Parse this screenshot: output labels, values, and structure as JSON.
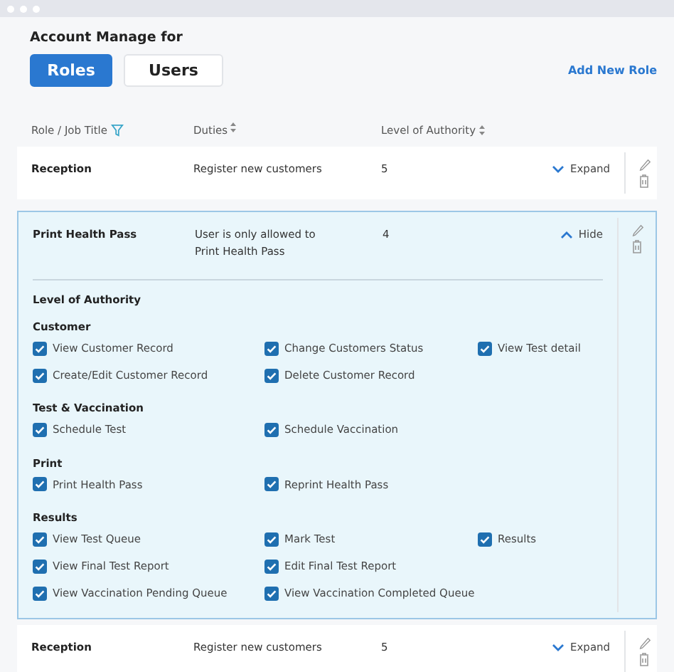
{
  "title": "Account Manage for",
  "tabs": [
    {
      "label": "Roles",
      "selected": true
    },
    {
      "label": "Users",
      "selected": false
    }
  ],
  "add_link": "Add New Role",
  "columns": [
    {
      "label": "Role / Job Title",
      "kind": "filter"
    },
    {
      "label": "Duties",
      "kind": "sort"
    },
    {
      "label": "Level of Authority",
      "kind": "sort"
    }
  ],
  "roles": [
    {
      "title": "Reception",
      "duties": "Register new customers",
      "level": "5",
      "expanded": false,
      "toggle": "Expand"
    },
    {
      "title": "Print Health Pass",
      "duties": "User is only allowed to Print Health Pass",
      "level": "4",
      "expanded": true,
      "toggle": "Hide",
      "permissions": {
        "heading": "Level of Authority",
        "groups": [
          {
            "name": "Customer",
            "rows": [
              [
                {
                  "label": "View Customer Record",
                  "checked": true
                },
                {
                  "label": "Change Customers Status",
                  "checked": true
                },
                {
                  "label": "View Test detail",
                  "checked": true
                }
              ],
              [
                {
                  "label": "Create/Edit Customer Record",
                  "checked": true
                },
                {
                  "label": "Delete Customer Record",
                  "checked": true
                }
              ]
            ]
          },
          {
            "name": "Test & Vaccination",
            "rows": [
              [
                {
                  "label": "Schedule Test",
                  "checked": true
                },
                {
                  "label": "Schedule Vaccination",
                  "checked": true
                }
              ]
            ]
          },
          {
            "name": "Print",
            "rows": [
              [
                {
                  "label": "Print Health Pass",
                  "checked": true
                },
                {
                  "label": "Reprint Health Pass",
                  "checked": true
                }
              ]
            ]
          },
          {
            "name": "Results",
            "rows": [
              [
                {
                  "label": "View Test Queue",
                  "checked": true
                },
                {
                  "label": "Mark Test",
                  "checked": true
                },
                {
                  "label": "Results",
                  "checked": true
                }
              ],
              [
                {
                  "label": "View Final Test Report",
                  "checked": true
                },
                {
                  "label": "Edit Final Test Report",
                  "checked": true
                }
              ],
              [
                {
                  "label": "View Vaccination Pending Queue",
                  "checked": true
                },
                {
                  "label": "View Vaccination Completed Queue",
                  "checked": true
                }
              ]
            ]
          }
        ]
      }
    },
    {
      "title": "Reception",
      "duties": "Register new customers",
      "level": "5",
      "expanded": false,
      "toggle": "Expand"
    }
  ]
}
